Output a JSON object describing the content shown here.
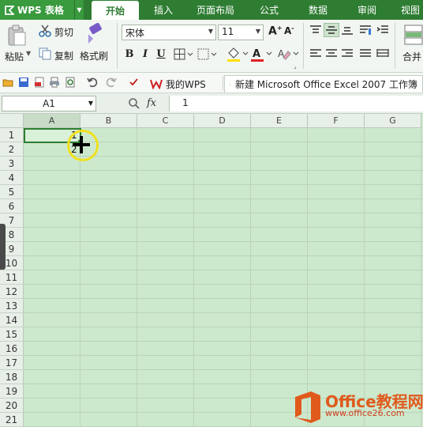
{
  "app": {
    "name": "WPS 表格",
    "tabs": [
      "开始",
      "插入",
      "页面布局",
      "公式",
      "数据",
      "审阅",
      "视图"
    ],
    "active_tab": "开始"
  },
  "ribbon": {
    "paste_label": "粘贴",
    "cut_label": "剪切",
    "copy_label": "复制",
    "format_painter_label": "格式刷",
    "font_name": "宋体",
    "font_size": "11",
    "bold": "B",
    "italic": "I",
    "underline": "U",
    "merge_label": "合并"
  },
  "quickbar": {
    "wps_tab_label": "我的WPS",
    "file_tab_label": "新建 Microsoft Office Excel 2007 工作簿"
  },
  "formula_bar": {
    "name_box": "A1",
    "fx_label": "fx",
    "content": "1"
  },
  "sheet": {
    "columns": [
      "A",
      "B",
      "C",
      "D",
      "E",
      "F",
      "G"
    ],
    "rows": [
      "1",
      "2",
      "3",
      "4",
      "5",
      "6",
      "7",
      "8",
      "9",
      "10",
      "11",
      "12",
      "13",
      "14",
      "15",
      "16",
      "17",
      "18",
      "19",
      "20",
      "21"
    ],
    "cells": [
      {
        "ref": "B1",
        "value": "1"
      },
      {
        "ref": "B2",
        "value": "2"
      }
    ]
  },
  "watermark": {
    "title": "Office教程网",
    "url": "www.office26.com"
  },
  "colors": {
    "accent": "#2f7d32",
    "grid_bg": "#cde9cd",
    "cursor_ring": "#f0e020",
    "watermark": "#e05a1c"
  }
}
